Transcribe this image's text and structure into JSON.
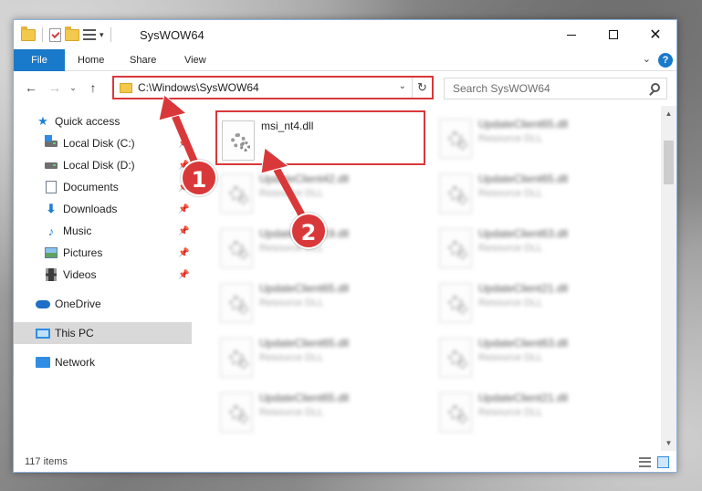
{
  "window": {
    "title": "SysWOW64"
  },
  "ribbon": {
    "tabs": [
      "File",
      "Home",
      "Share",
      "View"
    ]
  },
  "address_bar": {
    "path": "C:\\Windows\\SysWOW64"
  },
  "search": {
    "placeholder": "Search SysWOW64"
  },
  "sidebar": {
    "items": [
      {
        "label": "Quick access",
        "icon": "star-icon"
      },
      {
        "label": "Local Disk (C:)",
        "icon": "drive-icon",
        "pinned": true
      },
      {
        "label": "Local Disk (D:)",
        "icon": "drive-icon",
        "pinned": true
      },
      {
        "label": "Documents",
        "icon": "documents-icon",
        "pinned": true
      },
      {
        "label": "Downloads",
        "icon": "downloads-icon",
        "pinned": true
      },
      {
        "label": "Music",
        "icon": "music-icon",
        "pinned": true
      },
      {
        "label": "Pictures",
        "icon": "pictures-icon",
        "pinned": true
      },
      {
        "label": "Videos",
        "icon": "videos-icon",
        "pinned": true
      },
      {
        "label": "OneDrive",
        "icon": "cloud-icon"
      },
      {
        "label": "This PC",
        "icon": "computer-icon",
        "selected": true
      },
      {
        "label": "Network",
        "icon": "network-icon"
      }
    ]
  },
  "files": [
    {
      "name": "msi_nt4.dll",
      "type": "",
      "highlighted": true
    },
    {
      "name": "UpdateClient65.dll",
      "type": "Resource DLL"
    },
    {
      "name": "UpdateClient42.dll",
      "type": "Resource DLL"
    },
    {
      "name": "UpdateClient65.dll",
      "type": "Resource DLL"
    },
    {
      "name": "UpdateClient19.dll",
      "type": "Resource DLL"
    },
    {
      "name": "UpdateClient63.dll",
      "type": "Resource DLL"
    },
    {
      "name": "UpdateClient65.dll",
      "type": "Resource DLL"
    },
    {
      "name": "UpdateClient21.dll",
      "type": "Resource DLL"
    },
    {
      "name": "UpdateClient65.dll",
      "type": "Resource DLL"
    },
    {
      "name": "UpdateClient63.dll",
      "type": "Resource DLL"
    },
    {
      "name": "UpdateClient65.dll",
      "type": "Resource DLL"
    },
    {
      "name": "UpdateClient21.dll",
      "type": "Resource DLL"
    }
  ],
  "status": {
    "item_count": "117 items"
  },
  "annotations": {
    "step1": "1",
    "step2": "2",
    "color": "#d9383a"
  }
}
